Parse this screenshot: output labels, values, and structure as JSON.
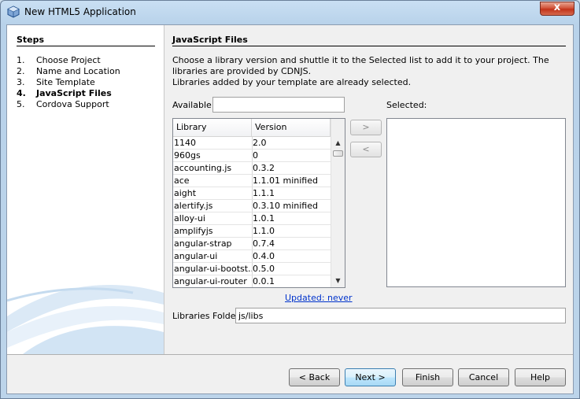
{
  "window": {
    "title": "New HTML5 Application",
    "close_glyph": "x"
  },
  "steps": {
    "heading": "Steps",
    "items": [
      {
        "num": "1.",
        "label": "Choose Project"
      },
      {
        "num": "2.",
        "label": "Name and Location"
      },
      {
        "num": "3.",
        "label": "Site Template"
      },
      {
        "num": "4.",
        "label": "JavaScript Files"
      },
      {
        "num": "5.",
        "label": "Cordova Support"
      }
    ],
    "current_index": 3
  },
  "panel": {
    "heading": "JavaScript Files",
    "description_line1": "Choose a library version and shuttle it to the Selected list to add it to your project. The libraries are provided by CDNJS.",
    "description_line2": "Libraries added by your template are already selected.",
    "available_label": "Available:",
    "available_value": "",
    "selected_label": "Selected:",
    "add_glyph": ">",
    "remove_glyph": "<",
    "updated_link": "Updated: never",
    "folder_label": "Libraries Folder:",
    "folder_value": "js/libs"
  },
  "table": {
    "columns": [
      "Library",
      "Version"
    ],
    "rows": [
      [
        "1140",
        "2.0"
      ],
      [
        "960gs",
        "0"
      ],
      [
        "accounting.js",
        "0.3.2"
      ],
      [
        "ace",
        "1.1.01 minified"
      ],
      [
        "aight",
        "1.1.1"
      ],
      [
        "alertify.js",
        "0.3.10 minified"
      ],
      [
        "alloy-ui",
        "1.0.1"
      ],
      [
        "amplifyjs",
        "1.1.0"
      ],
      [
        "angular-strap",
        "0.7.4"
      ],
      [
        "angular-ui",
        "0.4.0"
      ],
      [
        "angular-ui-bootst...",
        "0.5.0"
      ],
      [
        "angular-ui-router",
        "0.0.1"
      ]
    ]
  },
  "buttons": {
    "back": "< Back",
    "next": "Next >",
    "finish": "Finish",
    "cancel": "Cancel",
    "help": "Help"
  },
  "icons": {
    "scroll_up": "up-arrow-icon",
    "scroll_down": "down-arrow-icon",
    "app": "netbeans-cube-icon"
  }
}
